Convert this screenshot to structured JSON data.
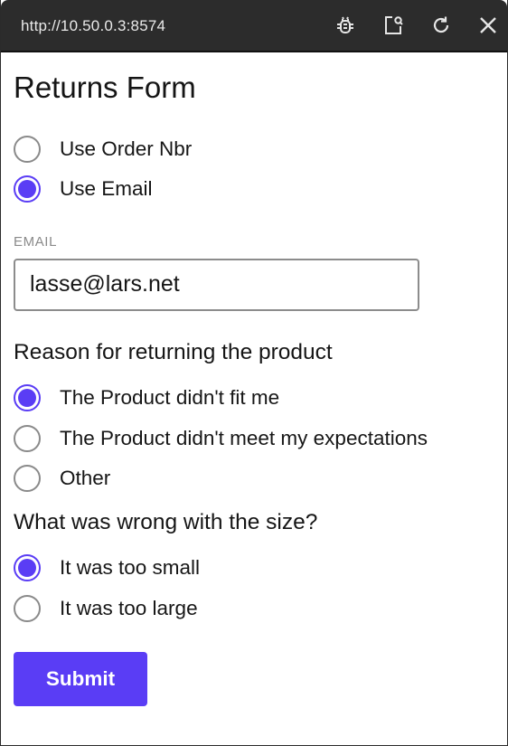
{
  "browser": {
    "url": "http://10.50.0.3:8574",
    "icons": [
      "bug-icon",
      "open-external-icon",
      "reload-icon",
      "close-icon"
    ]
  },
  "form": {
    "title": "Returns Form",
    "lookup_options": [
      {
        "label": "Use Order Nbr",
        "checked": false
      },
      {
        "label": "Use Email",
        "checked": true
      }
    ],
    "email_label": "EMAIL",
    "email_value": "lasse@lars.net",
    "reason_question": "Reason for returning the product",
    "reason_options": [
      {
        "label": "The Product didn't fit me",
        "checked": true
      },
      {
        "label": "The Product didn't meet my expectations",
        "checked": false
      },
      {
        "label": "Other",
        "checked": false
      }
    ],
    "size_question": "What was wrong with the size?",
    "size_options": [
      {
        "label": "It was too small",
        "checked": true
      },
      {
        "label": "It was too large",
        "checked": false
      }
    ],
    "submit_label": "Submit"
  },
  "colors": {
    "accent": "#5a3df5",
    "titlebar": "#2c2c2c"
  }
}
